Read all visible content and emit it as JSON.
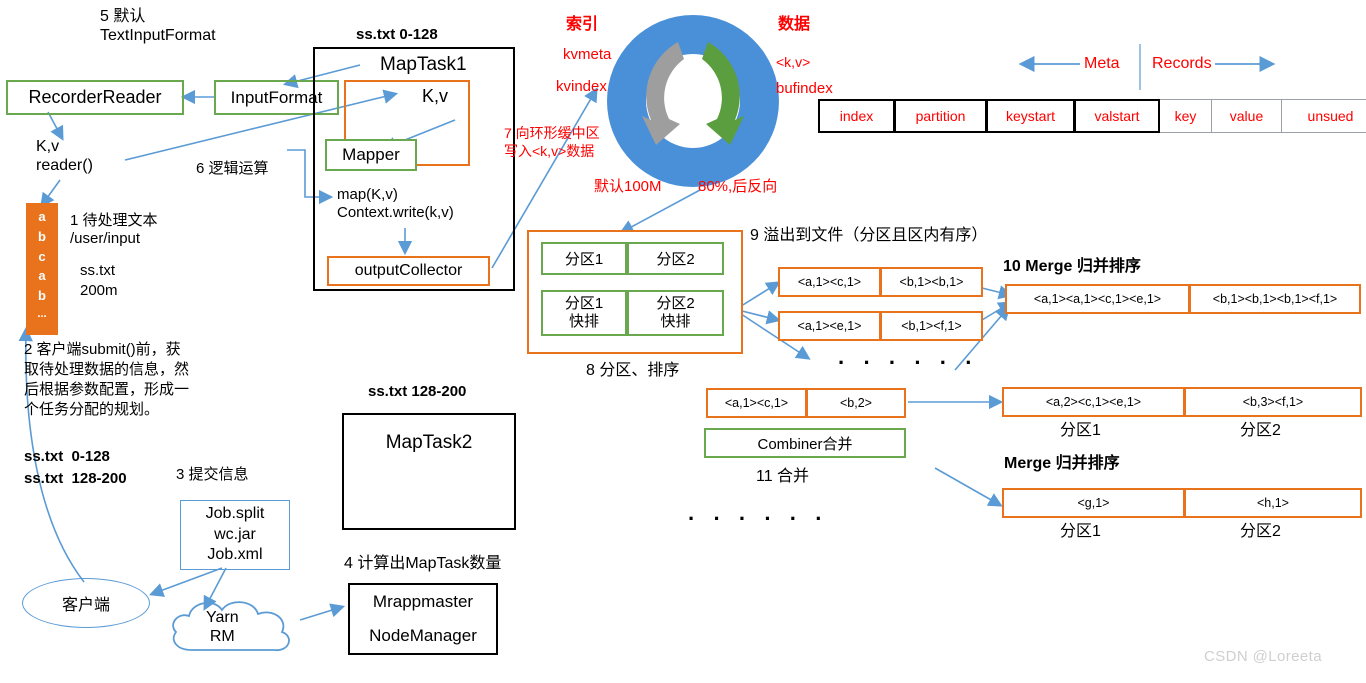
{
  "title": "MapReduce MapTask Shuffle Flow Diagram",
  "watermark": "CSDN @Loreeta",
  "left": {
    "step5": "5 默认\nTextInputFormat",
    "recorder_reader": "RecorderReader",
    "input_format": "InputFormat",
    "kv_reader": "K,v\nreader()",
    "file_block_letters": [
      "a",
      "b",
      "c",
      "a",
      "b",
      "..."
    ],
    "step1": "1 待处理文本\n/user/input",
    "file_name": "ss.txt",
    "file_size": "200m",
    "step2": "2 客户端submit()前，获\n取待处理数据的信息，然\n后根据参数配置，形成一\n个任务分配的规划。",
    "split1": "ss.txt  0-128",
    "split2": "ss.txt  128-200",
    "step3": "3 提交信息",
    "job_box": "Job.split\nwc.jar\nJob.xml",
    "client": "客户端",
    "yarn": "Yarn\nRM",
    "step4": "4 计算出MapTask数量",
    "mrapp": "Mrappmaster",
    "nodemanager": "NodeManager"
  },
  "maptask1": {
    "split_label": "ss.txt 0-128",
    "title": "MapTask1",
    "kv": "K,v",
    "mapper": "Mapper",
    "step6": "6 逻辑运算",
    "map_call": "map(K,v)\nContext.write(k,v)",
    "output_collector": "outputCollector"
  },
  "maptask2": {
    "split_label": "ss.txt 128-200",
    "title": "MapTask2"
  },
  "ringbuffer": {
    "index_label": "索引",
    "kvmeta": "kvmeta",
    "kvindex": "kvindex",
    "data_label": "数据",
    "kv": "<k,v>",
    "bufindex": "bufindex",
    "step7": "7 向环形缓中区\n写入<k,v>数据",
    "default_size": "默认100M",
    "threshold": "80%,后反向",
    "ring_color": "#4A90D9",
    "arrow_gray": "#9E9E9E",
    "arrow_green": "#5B9E3F"
  },
  "meta_records": {
    "meta_label": "Meta",
    "records_label": "Records",
    "meta_cells": [
      "index",
      "partition",
      "keystart",
      "valstart"
    ],
    "record_cells": [
      "key",
      "value",
      "unsued"
    ]
  },
  "partition_sort": {
    "step8": "8 分区、排序",
    "row1": [
      "分区1",
      "分区2"
    ],
    "row2": [
      "分区1\n快排",
      "分区2\n快排"
    ]
  },
  "spill": {
    "step9": "9 溢出到文件（分区且区内有序）",
    "file1": [
      "<a,1><c,1>",
      "<b,1><b,1>"
    ],
    "file2": [
      "<a,1><e,1>",
      "<b,1><f,1>"
    ],
    "dots": "· · ·   · · ·"
  },
  "merge10": {
    "title": "10 Merge 归并排序",
    "cells": [
      "<a,1><a,1><c,1><e,1>",
      "<b,1><b,1><b,1><f,1>"
    ]
  },
  "combine11": {
    "cells": [
      "<a,1><c,1>",
      "<b,2>"
    ],
    "combiner": "Combiner合并",
    "step11": "11 合并"
  },
  "result1": {
    "cells": [
      "<a,2><c,1><e,1>",
      "<b,3><f,1>"
    ],
    "labels": [
      "分区1",
      "分区2"
    ]
  },
  "merge_bottom": {
    "title": "Merge 归并排序",
    "cells": [
      "<g,1>",
      "<h,1>"
    ],
    "labels": [
      "分区1",
      "分区2"
    ],
    "dots": "· · ·   · · ·"
  }
}
